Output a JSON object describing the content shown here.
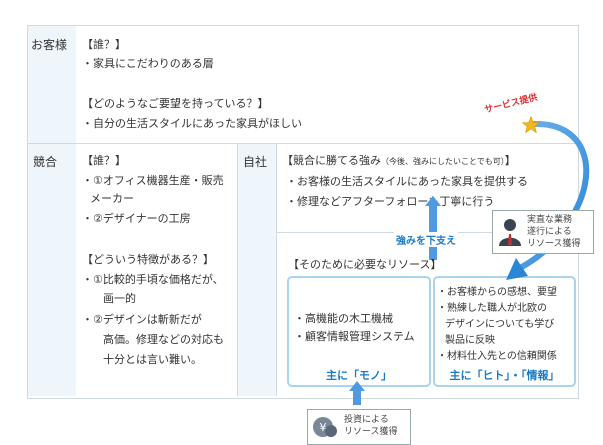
{
  "customer": {
    "label": "お客様",
    "who_header": "【誰？】",
    "who_item": "・家具にこだわりのある層",
    "needs_header": "【どのようなご要望を持っている？】",
    "needs_item": "・自分の生活スタイルにあった家具がほしい"
  },
  "competitor": {
    "label": "競合",
    "who_header": "【誰？】",
    "who_items": [
      "・①オフィス機器生産・販売",
      "メーカー",
      "・②デザイナーの工房"
    ],
    "features_header": "【どういう特徴がある？】",
    "features_items": [
      "・①比較的手頃な価格だが、",
      "画一的",
      "・②デザインは斬新だが",
      "高価。修理などの対応も",
      "十分とは言い難い。"
    ]
  },
  "company": {
    "label": "自社",
    "strength_header": "【競合に勝てる強み",
    "strength_note": "（今後、強みにしたいことでも可）",
    "strength_close": "】",
    "strength_items": [
      "・お客様の生活スタイルにあった家具を提供する",
      "・修理などアフターフォローも丁寧に行う"
    ],
    "support_label": "強みを下支え",
    "resources_header": "【そのために必要なリソース】",
    "mono_items": [
      "・高機能の木工機械",
      "・顧客情報管理システム"
    ],
    "mono_title": "主に「モノ」",
    "hito_items": [
      "・お客様からの感想、要望",
      "・熟練した職人が北欧の",
      "デザインについても学び",
      "製品に反映",
      "・材料仕入先との信頼関係"
    ],
    "hito_title": "主に「ヒト」・「情報」"
  },
  "service_label": "サービス提供",
  "badge_work": [
    "実直な業務",
    "遂行による",
    "リソース獲得"
  ],
  "badge_invest": [
    "投資による",
    "リソース獲得"
  ],
  "colors": {
    "accent_blue": "#1a7ac7",
    "box_border": "#a8d4f0",
    "label_bg": "#eef5fb",
    "divider": "#d0d8e0"
  }
}
